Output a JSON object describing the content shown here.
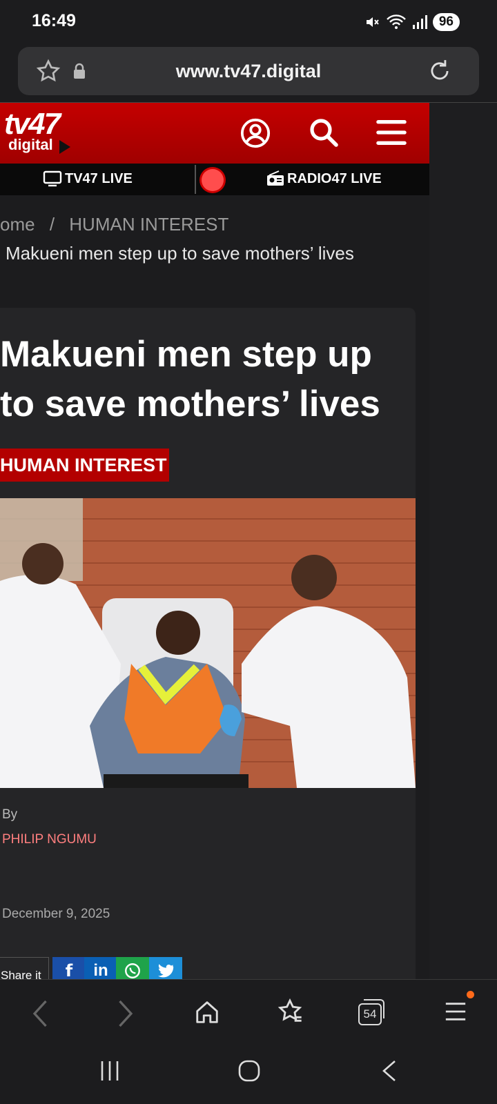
{
  "status": {
    "time": "16:49",
    "battery": "96"
  },
  "browser": {
    "url": "www.tv47.digital",
    "tabs_count": "54"
  },
  "site": {
    "logo_top": "tv47",
    "logo_bottom": "digital",
    "tv_live": "TV47 LIVE",
    "radio_live": "RADIO47 LIVE"
  },
  "breadcrumb": {
    "home": "ome",
    "sep": "/",
    "category": "HUMAN INTEREST",
    "current": "Makueni men step up to save mothers’ lives"
  },
  "article": {
    "headline_line1": "Makueni men step up",
    "headline_line2": "to save mothers’ lives",
    "category_tag": "HUMAN INTEREST",
    "by_label": "By",
    "author": "PHILIP NGUMU",
    "date": "December 9, 2025",
    "share_label": "Share it"
  },
  "colors": {
    "brand_red": "#b30000",
    "author": "#ff7f7f",
    "notif_dot": "#ff6a1a"
  }
}
